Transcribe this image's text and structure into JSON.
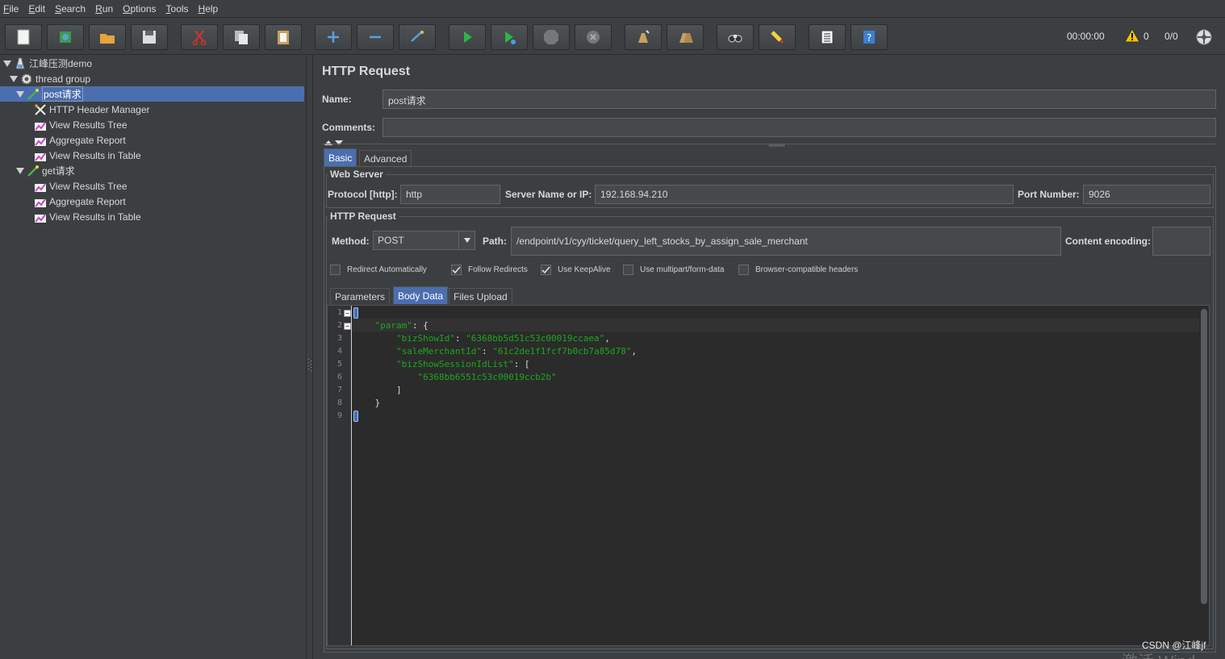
{
  "menu": [
    {
      "u": "F",
      "rest": "ile"
    },
    {
      "u": "E",
      "rest": "dit"
    },
    {
      "u": "S",
      "rest": "earch"
    },
    {
      "u": "R",
      "rest": "un"
    },
    {
      "u": "O",
      "rest": "ptions"
    },
    {
      "u": "T",
      "rest": "ools"
    },
    {
      "u": "H",
      "rest": "elp"
    }
  ],
  "toolbar": {
    "timer": "00:00:00",
    "warnings": "0",
    "threads": "0/0"
  },
  "tree": {
    "items": [
      {
        "label": "江峰压测demo",
        "icon": "test-plan-icon"
      },
      {
        "label": "thread group",
        "icon": "gear-icon"
      },
      {
        "label": "post请求",
        "icon": "sampler-icon"
      },
      {
        "label": "HTTP Header Manager",
        "icon": "tools-icon"
      },
      {
        "label": "View Results Tree",
        "icon": "listener-icon"
      },
      {
        "label": "Aggregate Report",
        "icon": "listener-icon"
      },
      {
        "label": "View Results in Table",
        "icon": "listener-icon"
      },
      {
        "label": "get请求",
        "icon": "sampler-icon"
      },
      {
        "label": "View Results Tree",
        "icon": "listener-icon"
      },
      {
        "label": "Aggregate Report",
        "icon": "listener-icon"
      },
      {
        "label": "View Results in Table",
        "icon": "listener-icon"
      }
    ]
  },
  "panel": {
    "title": "HTTP Request",
    "name_label": "Name:",
    "name_value": "post请求",
    "comments_label": "Comments:",
    "comments_value": "",
    "tabs": [
      "Basic",
      "Advanced"
    ],
    "web_server_title": "Web Server",
    "protocol_label": "Protocol [http]:",
    "protocol_value": "http",
    "server_label": "Server Name or IP:",
    "server_value": "192.168.94.210",
    "port_label": "Port Number:",
    "port_value": "9026",
    "http_request_title": "HTTP Request",
    "method_label": "Method:",
    "method_value": "POST",
    "path_label": "Path:",
    "path_value": "/endpoint/v1/cyy/ticket/query_left_stocks_by_assign_sale_merchant",
    "encoding_label": "Content encoding:",
    "encoding_value": "",
    "checkboxes": [
      {
        "label": "Redirect Automatically",
        "checked": false
      },
      {
        "label": "Follow Redirects",
        "checked": true
      },
      {
        "label": "Use KeepAlive",
        "checked": true
      },
      {
        "label": "Use multipart/form-data",
        "checked": false
      },
      {
        "label": "Browser-compatible headers",
        "checked": false
      }
    ],
    "subtabs": [
      "Parameters",
      "Body Data",
      "Files Upload"
    ]
  },
  "editor": {
    "lines": [
      {
        "n": "1",
        "text": "{"
      },
      {
        "n": "2",
        "text": "    \"param\": {"
      },
      {
        "n": "3",
        "text": "        \"bizShowId\": \"6368bb5d51c53c00019ccaea\","
      },
      {
        "n": "4",
        "text": "        \"saleMerchantId\": \"61c2de1f1fcf7b0cb7a85d78\","
      },
      {
        "n": "5",
        "text": "        \"bizShowSessionIdList\": ["
      },
      {
        "n": "6",
        "text": "            \"6368bb6551c53c00019ccb2b\""
      },
      {
        "n": "7",
        "text": "        ]"
      },
      {
        "n": "8",
        "text": "    }"
      },
      {
        "n": "9",
        "text": "}"
      }
    ]
  },
  "watermark": "CSDN @江峰jf",
  "watermark2": "激活 Wind"
}
